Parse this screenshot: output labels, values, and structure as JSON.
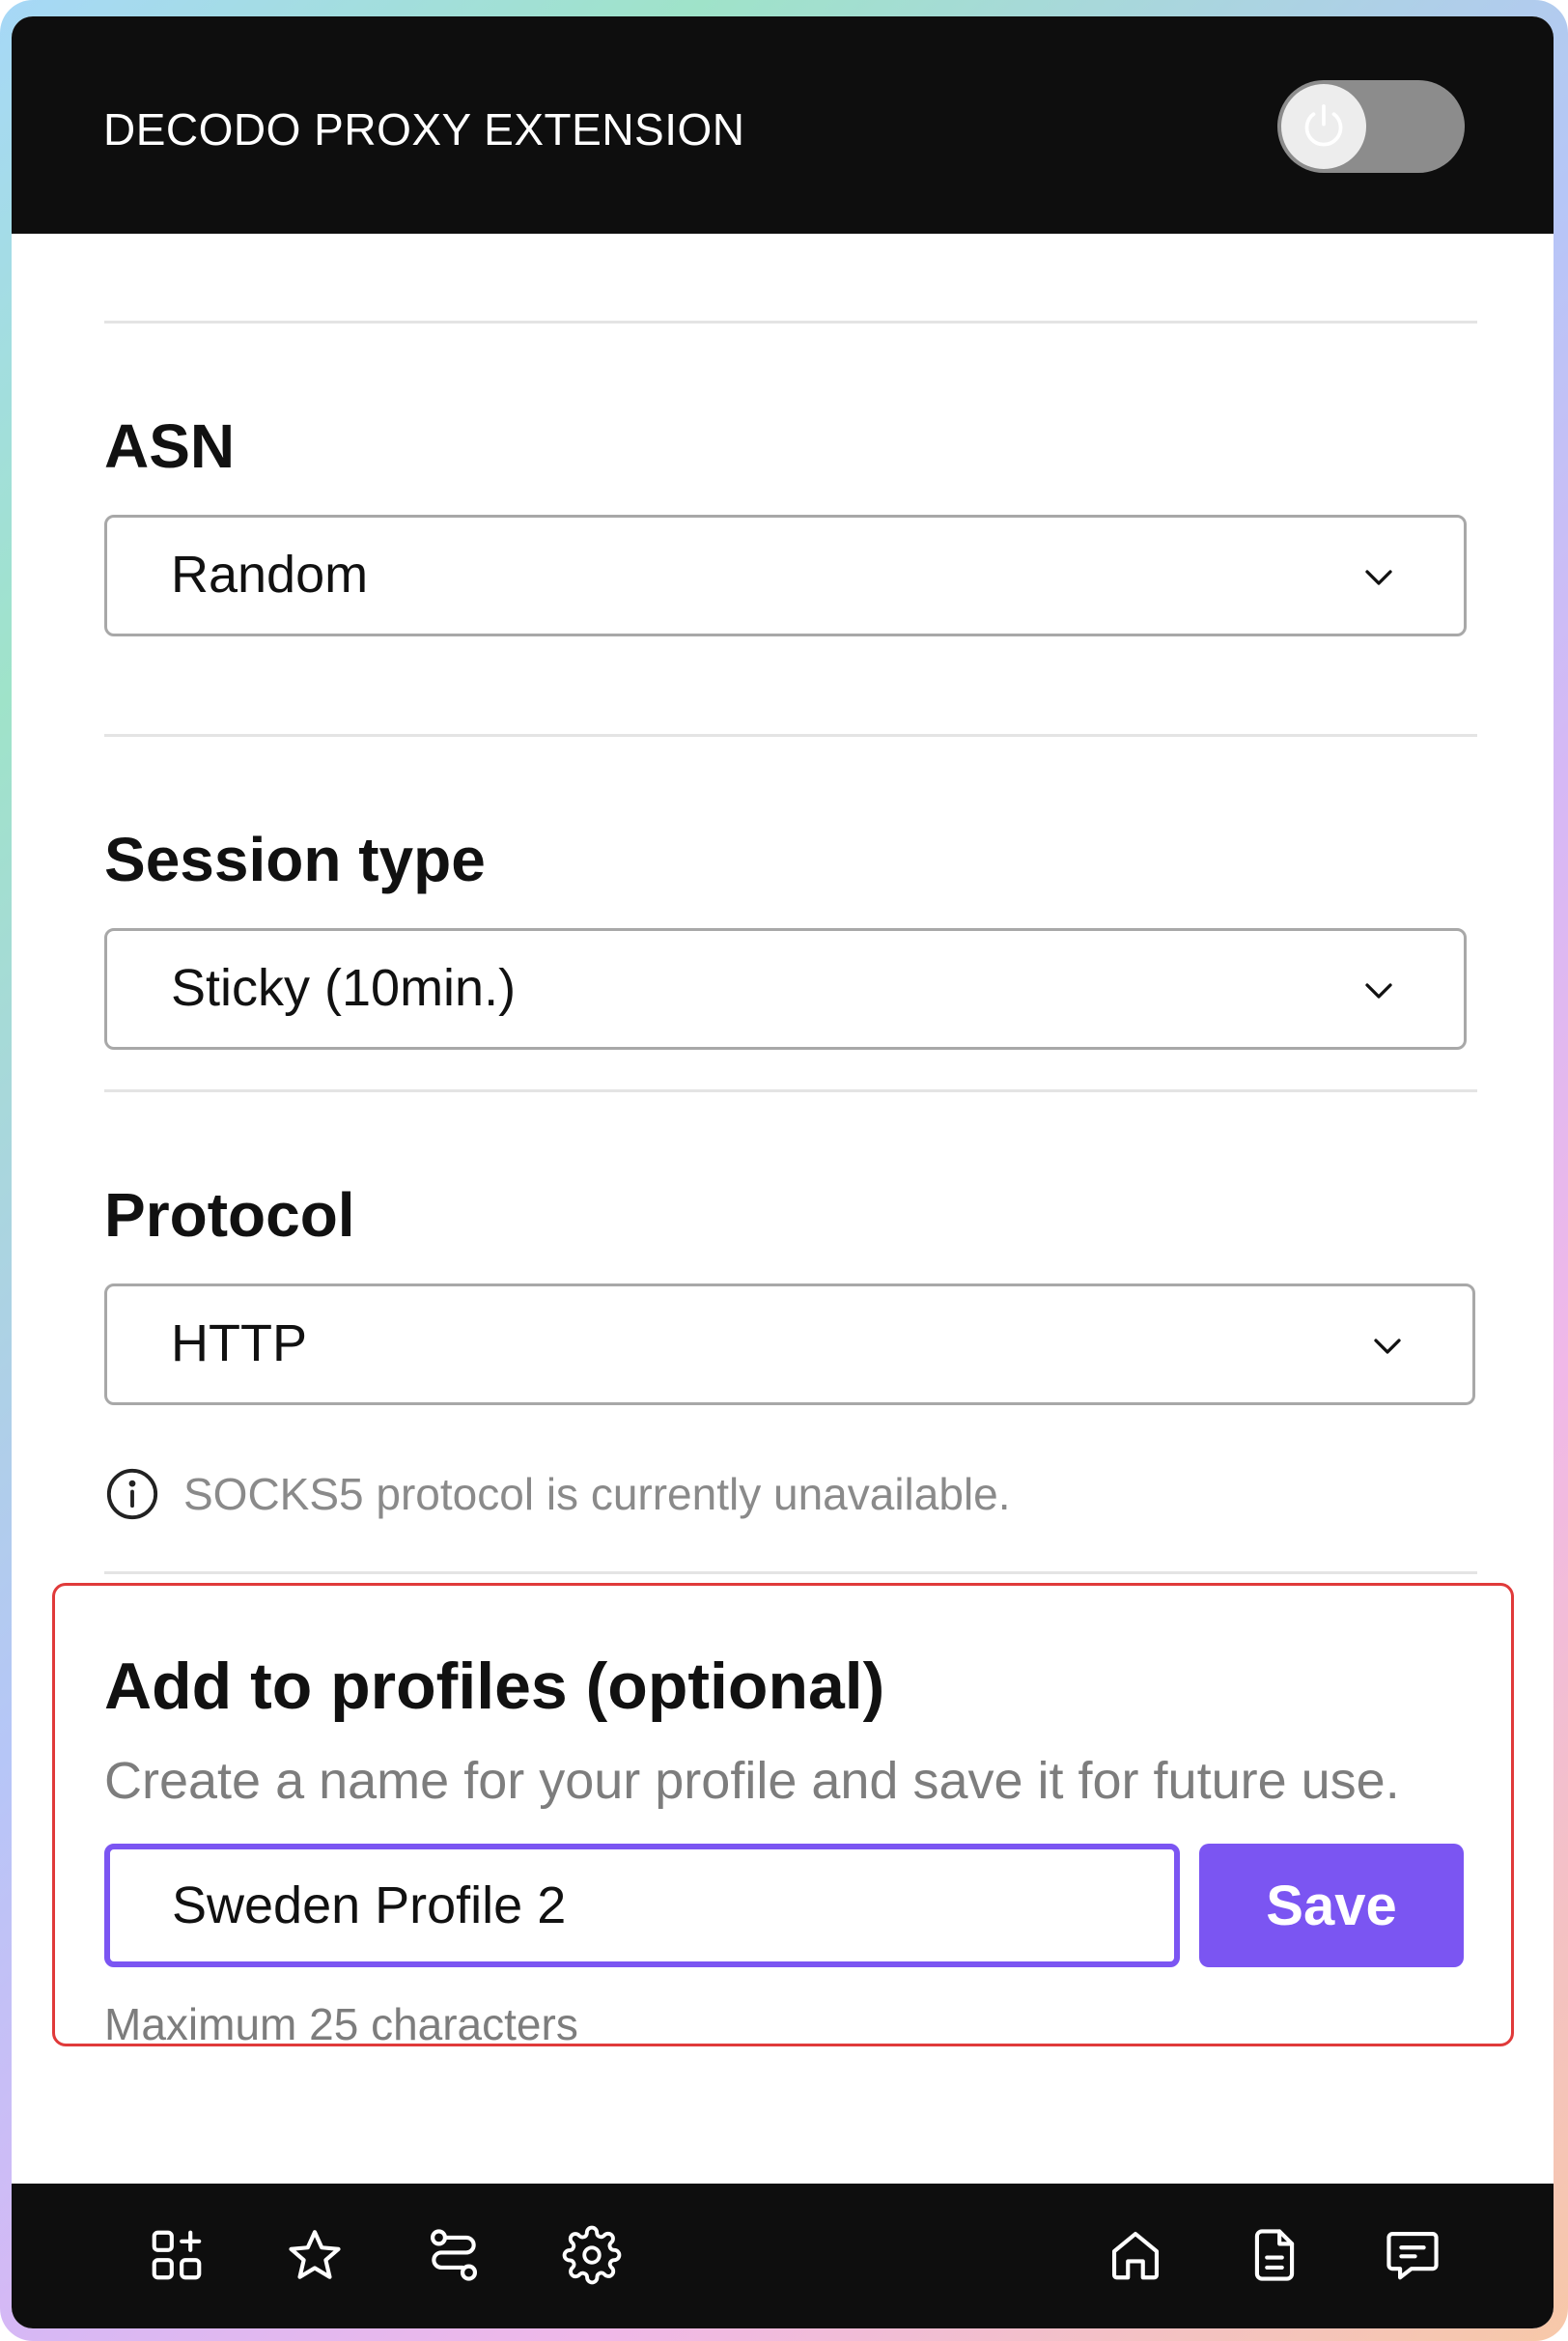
{
  "header": {
    "title": "DECODO PROXY EXTENSION",
    "power_toggle": {
      "icon": "power-icon",
      "state": "off"
    }
  },
  "asn": {
    "label": "ASN",
    "selected": "Random"
  },
  "session_type": {
    "label": "Session type",
    "selected": "Sticky (10min.)"
  },
  "protocol": {
    "label": "Protocol",
    "selected": "HTTP",
    "notice": "SOCKS5 protocol is currently unavailable."
  },
  "profile": {
    "title": "Add to profiles (optional)",
    "description": "Create a name for your profile and save it for future use.",
    "name_value": "Sweden Profile 2",
    "save_label": "Save",
    "hint": "Maximum 25 characters"
  },
  "footer_nav": {
    "left": [
      "apps-add-icon",
      "star-icon",
      "route-icon",
      "gear-icon"
    ],
    "right": [
      "home-icon",
      "document-icon",
      "chat-icon"
    ]
  },
  "colors": {
    "accent": "#7b55f2",
    "highlight_border": "#e03a3a",
    "header_bg": "#0e0e0e",
    "toggle_off": "#8c8c8c"
  }
}
